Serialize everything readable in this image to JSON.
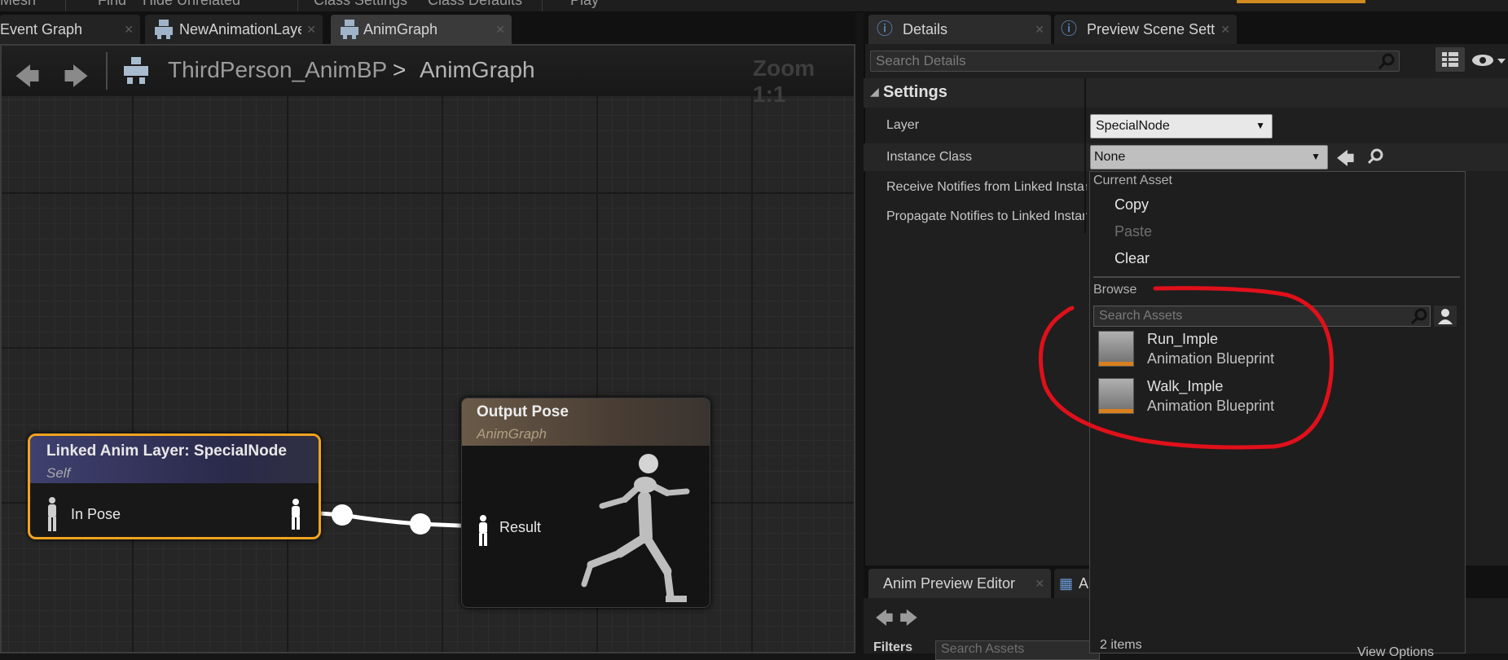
{
  "top_strip": {
    "items": [
      "Mesh",
      "Find",
      "Hide Unrelated",
      "Class Settings",
      "Class Defaults",
      "Play"
    ]
  },
  "left_tabs": [
    {
      "label": "Event Graph"
    },
    {
      "label": "NewAnimationLaye"
    },
    {
      "label": "AnimGraph"
    }
  ],
  "graph": {
    "breadcrumb_root": "ThirdPerson_AnimBP",
    "breadcrumb_sep": ">",
    "breadcrumb_current": "AnimGraph",
    "zoom": "Zoom 1:1",
    "nodes": {
      "linked": {
        "title": "Linked Anim Layer: SpecialNode",
        "subtitle": "Self",
        "pin": "In Pose"
      },
      "output": {
        "title": "Output Pose",
        "subtitle": "AnimGraph",
        "pin": "Result"
      }
    }
  },
  "right_tabs": [
    {
      "label": "Details"
    },
    {
      "label": "Preview Scene Sett"
    }
  ],
  "details": {
    "search_placeholder": "Search Details",
    "section": "Settings",
    "props": [
      {
        "label": "Layer",
        "value": "SpecialNode"
      },
      {
        "label": "Instance Class",
        "value": "None"
      },
      {
        "label": "Receive Notifies from Linked Instances"
      },
      {
        "label": "Propagate Notifies to Linked Instances"
      }
    ]
  },
  "popup": {
    "current_asset_heading": "Current Asset",
    "copy": "Copy",
    "paste": "Paste",
    "clear": "Clear",
    "browse_heading": "Browse",
    "search_placeholder": "Search Assets",
    "assets": [
      {
        "name": "Run_Imple",
        "type": "Animation Blueprint"
      },
      {
        "name": "Walk_Imple",
        "type": "Animation Blueprint"
      }
    ],
    "count": "2 items",
    "view_options": "View Options"
  },
  "bottom": {
    "tab": "Anim Preview Editor",
    "tab2_initial": "A",
    "filters": "Filters",
    "search_placeholder": "Search Assets"
  },
  "colors": {
    "selection_outline": "#f0a31f",
    "annotation": "#e0101a"
  }
}
